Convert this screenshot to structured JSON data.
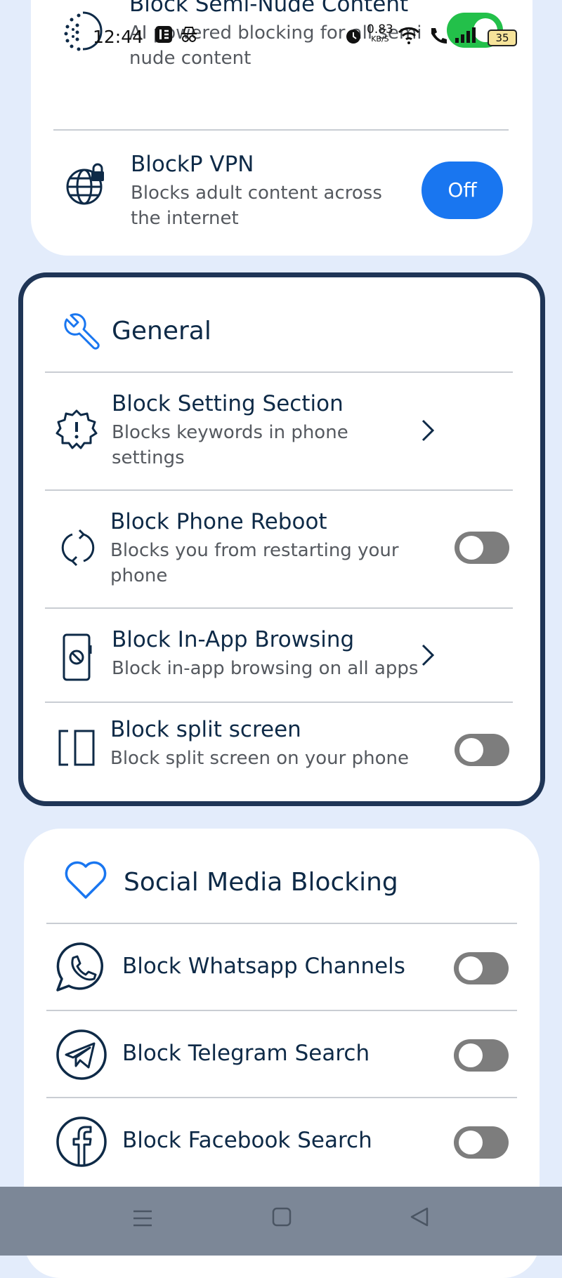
{
  "status_bar": {
    "time": "12:44",
    "net_speed_value": "0.83",
    "net_speed_unit": "KB/S",
    "battery": "35"
  },
  "top_section": {
    "semi_nude": {
      "title": "Block Semi-Nude Content",
      "desc_line1": "AI powered blocking for all semi",
      "desc_line2": "nude content",
      "state": "on"
    },
    "vpn": {
      "title": "BlockP VPN",
      "desc_line1": "Blocks adult content across",
      "desc_line2": "the internet",
      "button": "Off"
    }
  },
  "general": {
    "title": "General",
    "items": [
      {
        "title": "Block Setting Section",
        "desc_line1": "Blocks keywords in phone",
        "desc_line2": "settings",
        "control": "chevron"
      },
      {
        "title": "Block Phone Reboot",
        "desc_line1": "Blocks you from restarting your",
        "desc_line2": "phone",
        "control": "toggle-off"
      },
      {
        "title": "Block In-App Browsing",
        "desc_line1": "Block in-app browsing on all apps",
        "control": "chevron"
      },
      {
        "title": "Block split screen",
        "desc_line1": "Block split screen on your phone",
        "control": "toggle-off"
      }
    ]
  },
  "social": {
    "title": "Social Media Blocking",
    "items": [
      {
        "title": "Block Whatsapp Channels",
        "control": "toggle-off"
      },
      {
        "title": "Block Telegram Search",
        "control": "toggle-off"
      },
      {
        "title": "Block Facebook Search",
        "control": "toggle-off"
      }
    ]
  },
  "colors": {
    "accent_blue": "#1976f0",
    "toggle_on": "#23c04a",
    "toggle_off": "#7d7d7d",
    "text_dark": "#0e2a47",
    "page_bg": "#e3ecfb",
    "general_border": "#1f3556"
  },
  "icons": {
    "semi_nude": "dotted-circle-icon",
    "vpn": "globe-lock-icon",
    "general": "wrench-icon",
    "setting_section": "gear-alert-icon",
    "reboot": "restart-icon",
    "in_app": "phone-block-icon",
    "split_screen": "split-screen-icon",
    "social": "heart-icon",
    "whatsapp": "whatsapp-icon",
    "telegram": "telegram-icon",
    "facebook": "facebook-icon"
  }
}
